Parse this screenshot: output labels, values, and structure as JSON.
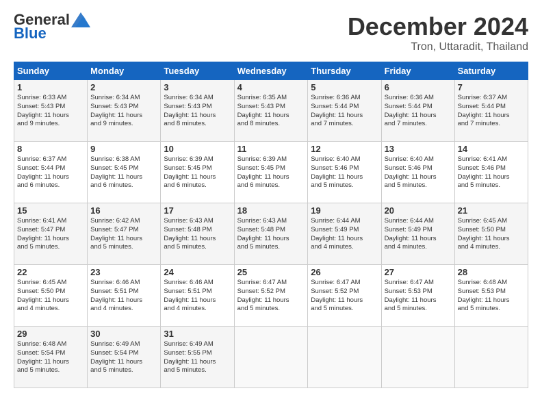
{
  "header": {
    "logo_text_general": "General",
    "logo_text_blue": "Blue",
    "month": "December 2024",
    "location": "Tron, Uttaradit, Thailand"
  },
  "weekdays": [
    "Sunday",
    "Monday",
    "Tuesday",
    "Wednesday",
    "Thursday",
    "Friday",
    "Saturday"
  ],
  "weeks": [
    [
      {
        "day": "1",
        "info": "Sunrise: 6:33 AM\nSunset: 5:43 PM\nDaylight: 11 hours\nand 9 minutes."
      },
      {
        "day": "2",
        "info": "Sunrise: 6:34 AM\nSunset: 5:43 PM\nDaylight: 11 hours\nand 9 minutes."
      },
      {
        "day": "3",
        "info": "Sunrise: 6:34 AM\nSunset: 5:43 PM\nDaylight: 11 hours\nand 8 minutes."
      },
      {
        "day": "4",
        "info": "Sunrise: 6:35 AM\nSunset: 5:43 PM\nDaylight: 11 hours\nand 8 minutes."
      },
      {
        "day": "5",
        "info": "Sunrise: 6:36 AM\nSunset: 5:44 PM\nDaylight: 11 hours\nand 7 minutes."
      },
      {
        "day": "6",
        "info": "Sunrise: 6:36 AM\nSunset: 5:44 PM\nDaylight: 11 hours\nand 7 minutes."
      },
      {
        "day": "7",
        "info": "Sunrise: 6:37 AM\nSunset: 5:44 PM\nDaylight: 11 hours\nand 7 minutes."
      }
    ],
    [
      {
        "day": "8",
        "info": "Sunrise: 6:37 AM\nSunset: 5:44 PM\nDaylight: 11 hours\nand 6 minutes."
      },
      {
        "day": "9",
        "info": "Sunrise: 6:38 AM\nSunset: 5:45 PM\nDaylight: 11 hours\nand 6 minutes."
      },
      {
        "day": "10",
        "info": "Sunrise: 6:39 AM\nSunset: 5:45 PM\nDaylight: 11 hours\nand 6 minutes."
      },
      {
        "day": "11",
        "info": "Sunrise: 6:39 AM\nSunset: 5:45 PM\nDaylight: 11 hours\nand 6 minutes."
      },
      {
        "day": "12",
        "info": "Sunrise: 6:40 AM\nSunset: 5:46 PM\nDaylight: 11 hours\nand 5 minutes."
      },
      {
        "day": "13",
        "info": "Sunrise: 6:40 AM\nSunset: 5:46 PM\nDaylight: 11 hours\nand 5 minutes."
      },
      {
        "day": "14",
        "info": "Sunrise: 6:41 AM\nSunset: 5:46 PM\nDaylight: 11 hours\nand 5 minutes."
      }
    ],
    [
      {
        "day": "15",
        "info": "Sunrise: 6:41 AM\nSunset: 5:47 PM\nDaylight: 11 hours\nand 5 minutes."
      },
      {
        "day": "16",
        "info": "Sunrise: 6:42 AM\nSunset: 5:47 PM\nDaylight: 11 hours\nand 5 minutes."
      },
      {
        "day": "17",
        "info": "Sunrise: 6:43 AM\nSunset: 5:48 PM\nDaylight: 11 hours\nand 5 minutes."
      },
      {
        "day": "18",
        "info": "Sunrise: 6:43 AM\nSunset: 5:48 PM\nDaylight: 11 hours\nand 5 minutes."
      },
      {
        "day": "19",
        "info": "Sunrise: 6:44 AM\nSunset: 5:49 PM\nDaylight: 11 hours\nand 4 minutes."
      },
      {
        "day": "20",
        "info": "Sunrise: 6:44 AM\nSunset: 5:49 PM\nDaylight: 11 hours\nand 4 minutes."
      },
      {
        "day": "21",
        "info": "Sunrise: 6:45 AM\nSunset: 5:50 PM\nDaylight: 11 hours\nand 4 minutes."
      }
    ],
    [
      {
        "day": "22",
        "info": "Sunrise: 6:45 AM\nSunset: 5:50 PM\nDaylight: 11 hours\nand 4 minutes."
      },
      {
        "day": "23",
        "info": "Sunrise: 6:46 AM\nSunset: 5:51 PM\nDaylight: 11 hours\nand 4 minutes."
      },
      {
        "day": "24",
        "info": "Sunrise: 6:46 AM\nSunset: 5:51 PM\nDaylight: 11 hours\nand 4 minutes."
      },
      {
        "day": "25",
        "info": "Sunrise: 6:47 AM\nSunset: 5:52 PM\nDaylight: 11 hours\nand 5 minutes."
      },
      {
        "day": "26",
        "info": "Sunrise: 6:47 AM\nSunset: 5:52 PM\nDaylight: 11 hours\nand 5 minutes."
      },
      {
        "day": "27",
        "info": "Sunrise: 6:47 AM\nSunset: 5:53 PM\nDaylight: 11 hours\nand 5 minutes."
      },
      {
        "day": "28",
        "info": "Sunrise: 6:48 AM\nSunset: 5:53 PM\nDaylight: 11 hours\nand 5 minutes."
      }
    ],
    [
      {
        "day": "29",
        "info": "Sunrise: 6:48 AM\nSunset: 5:54 PM\nDaylight: 11 hours\nand 5 minutes."
      },
      {
        "day": "30",
        "info": "Sunrise: 6:49 AM\nSunset: 5:54 PM\nDaylight: 11 hours\nand 5 minutes."
      },
      {
        "day": "31",
        "info": "Sunrise: 6:49 AM\nSunset: 5:55 PM\nDaylight: 11 hours\nand 5 minutes."
      },
      null,
      null,
      null,
      null
    ]
  ]
}
